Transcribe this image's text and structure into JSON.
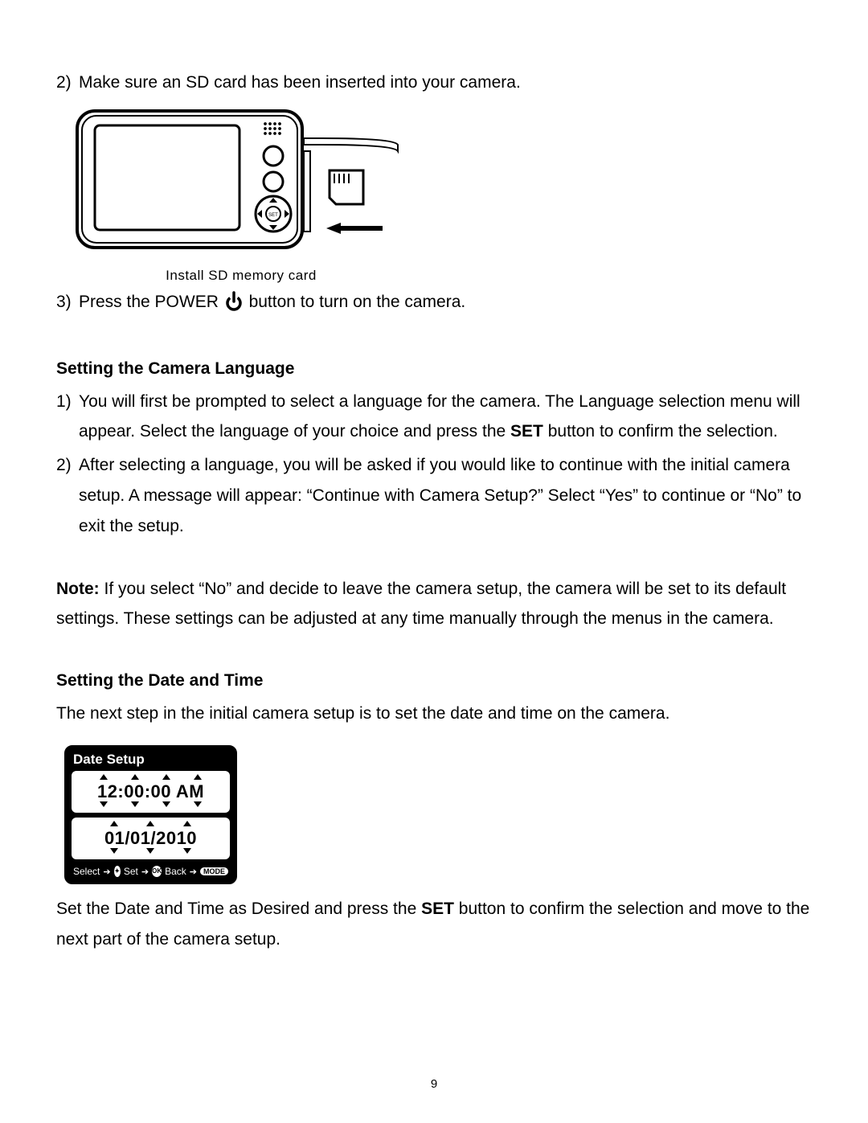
{
  "step2": {
    "num": "2)",
    "text": "Make sure an SD card has been inserted into your camera."
  },
  "figure1": {
    "caption": "Install SD memory card"
  },
  "step3": {
    "num": "3)",
    "text_before": "Press the POWER ",
    "text_after": " button to turn on the camera."
  },
  "section_language": {
    "title": "Setting the Camera Language",
    "item1": {
      "num": "1)",
      "text_a": "You will first be prompted to select a language for the camera. The Language selection menu will appear. Select the language of your choice and press the ",
      "set": "SET",
      "text_b": " button to confirm the selection."
    },
    "item2": {
      "num": "2)",
      "text": "After selecting a language, you will be asked if you would like to continue with the initial camera setup. A message will appear: “Continue with Camera Setup?” Select “Yes” to continue or “No” to exit the setup."
    }
  },
  "note": {
    "label": "Note:",
    "text": " If you select “No” and decide to leave the camera setup, the camera will be set to its default settings. These settings can be adjusted at any time manually through the menus in the camera."
  },
  "section_date": {
    "title": "Setting the Date and Time",
    "intro": "The next step in the initial camera setup is to set the date and time on the camera.",
    "panel_title": "Date Setup",
    "time_value": "12:00:00 AM",
    "date_value": "01/01/2010",
    "footer_select": "Select",
    "footer_set": "Set",
    "footer_back": "Back",
    "footer_mode": "MODE",
    "after_a": "Set the Date and Time as Desired and press the ",
    "set": "SET",
    "after_b": " button to confirm the selection and move to the next part of the camera setup."
  },
  "page_number": "9"
}
